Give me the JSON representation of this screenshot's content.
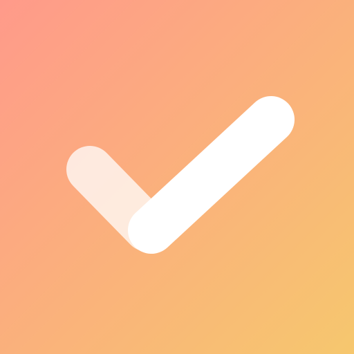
{
  "icon": {
    "name": "checkmark-icon",
    "colors": {
      "gradient_start": "#FF9A8A",
      "gradient_end": "#F6C76E",
      "check_primary": "#FFFFFF",
      "check_secondary": "#FFFFFF",
      "check_secondary_opacity": "0.75"
    }
  }
}
